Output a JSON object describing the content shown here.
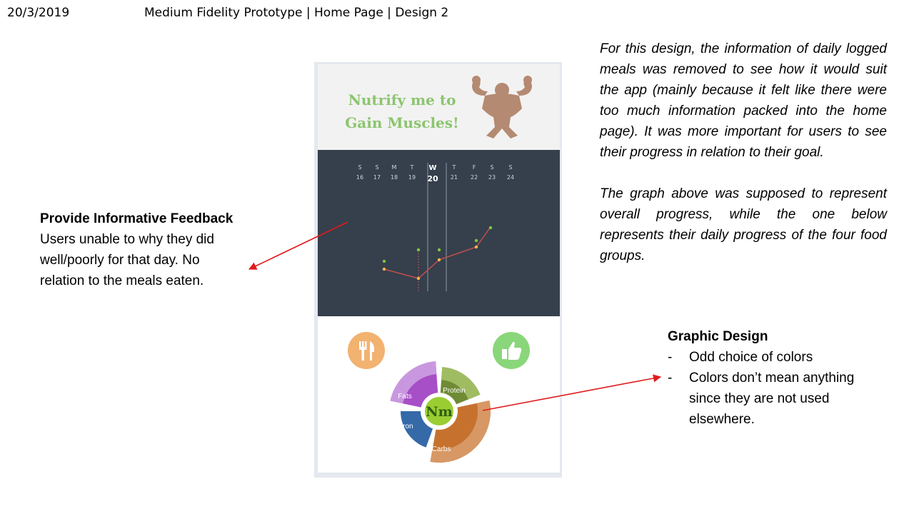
{
  "header": {
    "date": "20/3/2019",
    "title": "Medium Fidelity Prototype | Home Page | Design 2"
  },
  "app": {
    "title": "Nutrify me to Gain Muscles!",
    "goal_icon": "flexing-strongman-icon",
    "week": [
      {
        "letter": "S",
        "num": "16",
        "active": false
      },
      {
        "letter": "S",
        "num": "17",
        "active": false
      },
      {
        "letter": "M",
        "num": "18",
        "active": false
      },
      {
        "letter": "T",
        "num": "19",
        "active": false
      },
      {
        "letter": "W",
        "num": "20",
        "active": true
      },
      {
        "letter": "T",
        "num": "21",
        "active": false
      },
      {
        "letter": "F",
        "num": "22",
        "active": false
      },
      {
        "letter": "S",
        "num": "23",
        "active": false
      },
      {
        "letter": "S",
        "num": "24",
        "active": false
      }
    ],
    "meal_icon": "fork-knife-icon",
    "like_icon": "thumbs-up-icon",
    "logo_text": "Nm",
    "food_groups": [
      {
        "label": "Fats",
        "color": "#a74fc6"
      },
      {
        "label": "Protein",
        "color": "#6f8b35"
      },
      {
        "label": "Carbs",
        "color": "#c6722e"
      },
      {
        "label": "Iron",
        "color": "#3569a8"
      }
    ],
    "colors": {
      "title": "#8cc56e",
      "graph_bg": "#363f4c",
      "line": "#c0504d",
      "point": "#f2b84b",
      "target_point": "#7ac943"
    }
  },
  "annotations": {
    "feedback": {
      "title": "Provide Informative Feedback",
      "body": "Users unable to why they did well/poorly for that day. No relation to the meals eaten."
    },
    "graphic_design": {
      "title": "Graphic Design",
      "points": [
        "Odd choice of colors",
        "Colors don’t mean anything since they are not used elsewhere."
      ]
    },
    "description": [
      "For this design, the information of daily logged meals was removed to see how it would suit the app (mainly because it felt like there were too much information packed into the home page). It was more important for users to see their progress in relation to their goal.",
      "The graph above was supposed to represent overall progress, while the one below represents their daily progress of the four food groups."
    ]
  }
}
